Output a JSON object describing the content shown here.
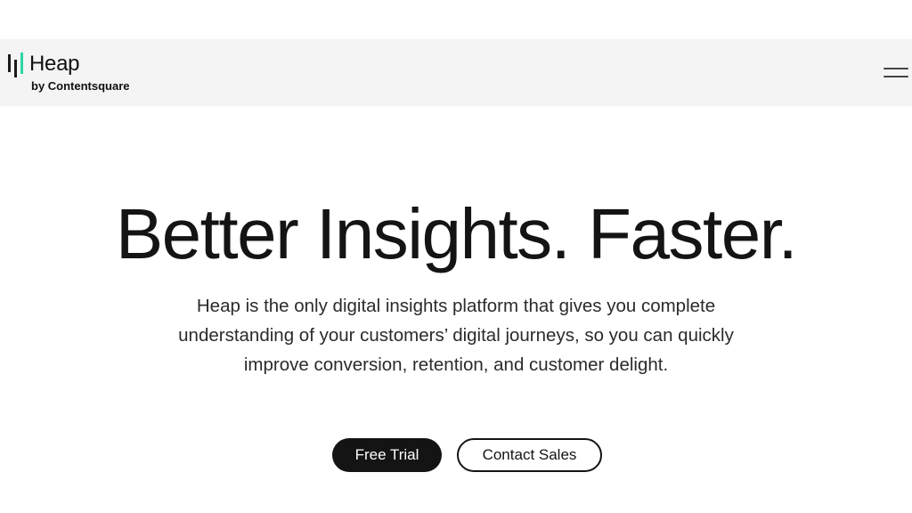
{
  "header": {
    "logo_text": "Heap",
    "logo_subtext": "by Contentsquare",
    "brand_accent": "#2dd4a7",
    "menu_icon": "hamburger-menu-icon"
  },
  "hero": {
    "title": "Better Insights. Faster.",
    "description": "Heap is the only digital insights platform that gives you complete understanding of your customers’ digital journeys, so you can quickly improve conversion, retention, and customer delight.",
    "primary_button": "Free Trial",
    "secondary_button": "Contact Sales"
  },
  "colors": {
    "text": "#141414",
    "header_background": "#f4f4f4",
    "primary_button_background": "#141414"
  }
}
